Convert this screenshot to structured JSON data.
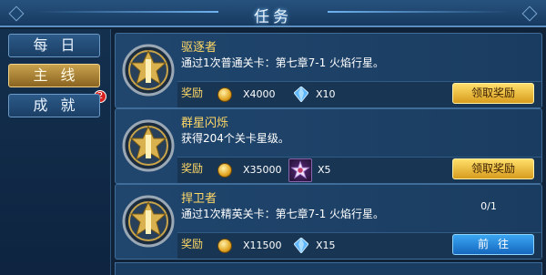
{
  "window": {
    "title": "任务"
  },
  "tabs": [
    {
      "label": "每日",
      "active": false
    },
    {
      "label": "主线",
      "active": true,
      "badge": "2"
    },
    {
      "label": "成就",
      "active": false
    }
  ],
  "quests": [
    {
      "name": "驱逐者",
      "description": "通过1次普通关卡：第七章7-1 火焰行星。",
      "reward_label": "奖励",
      "rewards": [
        {
          "icon": "gold-coin-icon",
          "amount": "X4000"
        },
        {
          "icon": "blue-crystal-icon",
          "amount": "X10"
        }
      ],
      "progress": "",
      "button": {
        "label": "领取奖励",
        "style": "gold"
      }
    },
    {
      "name": "群星闪烁",
      "description": "获得204个关卡星级。",
      "reward_label": "奖励",
      "rewards": [
        {
          "icon": "gold-coin-icon",
          "amount": "X35000"
        },
        {
          "icon": "star-emblem-icon",
          "amount": "X5"
        }
      ],
      "progress": "",
      "button": {
        "label": "领取奖励",
        "style": "gold"
      }
    },
    {
      "name": "捍卫者",
      "description": "通过1次精英关卡：第七章7-1 火焰行星。",
      "reward_label": "奖励",
      "rewards": [
        {
          "icon": "gold-coin-icon",
          "amount": "X11500"
        },
        {
          "icon": "blue-crystal-icon",
          "amount": "X15"
        }
      ],
      "progress": "0/1",
      "button": {
        "label": "前往",
        "style": "blue"
      }
    }
  ],
  "colors": {
    "accent_gold": "#ffd866",
    "panel_blue": "#1a3c60",
    "button_gold": "#e8b43a",
    "button_blue": "#2a86d8",
    "badge_red": "#d7201d"
  }
}
